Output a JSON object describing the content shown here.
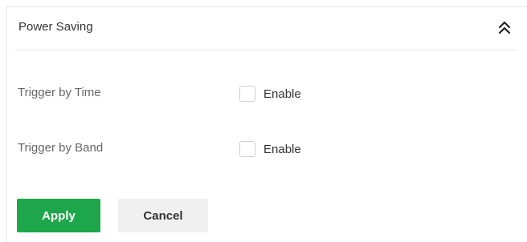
{
  "panel": {
    "title": "Power Saving",
    "collapse_icon": "double-chevron-up-icon"
  },
  "rows": [
    {
      "label": "Trigger by Time",
      "checkbox_label": "Enable",
      "checked": false
    },
    {
      "label": "Trigger by Band",
      "checkbox_label": "Enable",
      "checked": false
    }
  ],
  "buttons": {
    "apply_label": "Apply",
    "cancel_label": "Cancel"
  },
  "colors": {
    "apply_bg": "#1ea64a",
    "cancel_bg": "#f0f0f0",
    "border": "#e4e4e4"
  }
}
